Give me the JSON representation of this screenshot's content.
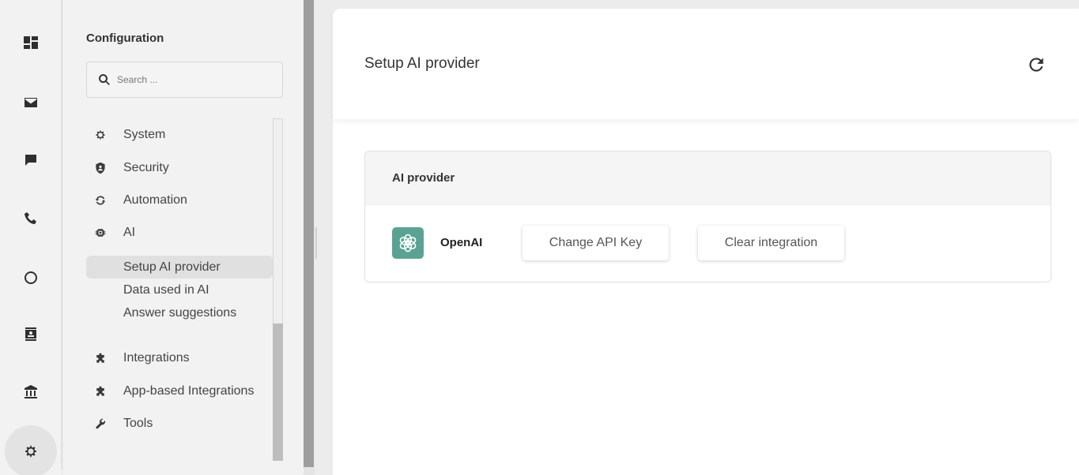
{
  "rail": {
    "items": [
      {
        "name": "dashboard-icon"
      },
      {
        "name": "mail-icon"
      },
      {
        "name": "chat-icon"
      },
      {
        "name": "phone-icon"
      },
      {
        "name": "circle-icon"
      },
      {
        "name": "contact-card-icon"
      },
      {
        "name": "bank-icon"
      },
      {
        "name": "gear-icon",
        "active": true
      }
    ]
  },
  "sidebar": {
    "title": "Configuration",
    "search_placeholder": "Search ...",
    "items": [
      {
        "label": "System",
        "icon": "gear-icon"
      },
      {
        "label": "Security",
        "icon": "shield-icon"
      },
      {
        "label": "Automation",
        "icon": "sync-icon"
      },
      {
        "label": "AI",
        "icon": "chip-icon"
      },
      {
        "label": "Integrations",
        "icon": "puzzle-icon"
      },
      {
        "label": "App-based Integrations",
        "icon": "puzzle-icon"
      },
      {
        "label": "Tools",
        "icon": "wrench-icon"
      }
    ],
    "ai_sub_items": [
      {
        "label": "Setup AI provider",
        "active": true
      },
      {
        "label": "Data used in AI"
      },
      {
        "label": "Answer suggestions"
      }
    ]
  },
  "main": {
    "title": "Setup AI provider",
    "refresh_icon": "refresh-icon",
    "card": {
      "title": "AI provider",
      "provider_name": "OpenAI",
      "provider_logo": "openai-logo-icon",
      "logo_color": "#5aa392",
      "change_key_label": "Change API Key",
      "clear_label": "Clear integration"
    }
  }
}
